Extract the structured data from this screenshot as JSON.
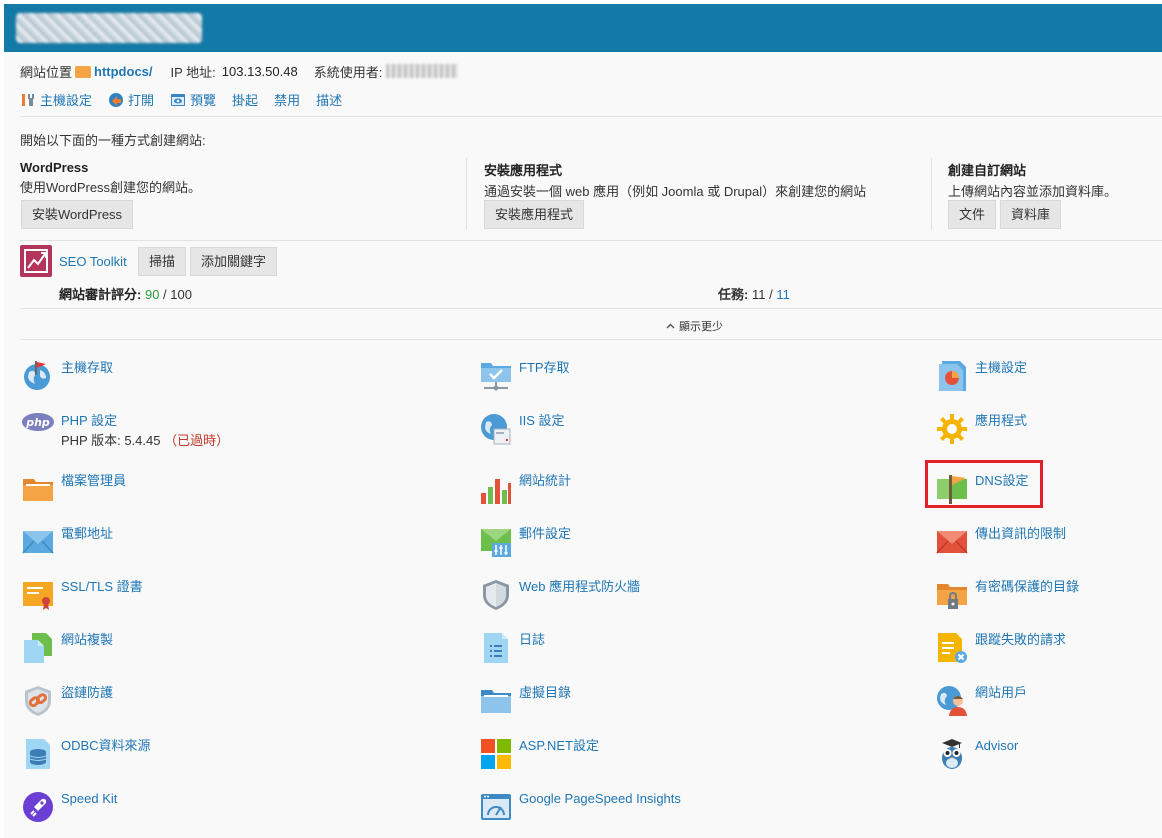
{
  "header": {
    "site_label": "網站位置",
    "site_path": "httpdocs/",
    "ip_label": "IP 地址:",
    "ip_value": "103.13.50.48",
    "user_label": "系統使用者:"
  },
  "actions": [
    {
      "label": "主機設定",
      "icon": "tools-icon"
    },
    {
      "label": "打開",
      "icon": "open-icon"
    },
    {
      "label": "預覽",
      "icon": "preview-icon"
    },
    {
      "label": "掛起",
      "icon": ""
    },
    {
      "label": "禁用",
      "icon": ""
    },
    {
      "label": "描述",
      "icon": ""
    }
  ],
  "create": {
    "intro": "開始以下面的一種方式創建網站:",
    "wordpress": {
      "title": "WordPress",
      "desc": "使用WordPress創建您的網站。",
      "button": "安裝WordPress"
    },
    "apps": {
      "title": "安裝應用程式",
      "desc": "通過安裝一個 web 應用（例如 Joomla 或 Drupal）來創建您的網站",
      "button": "安裝應用程式"
    },
    "custom": {
      "title": "創建自訂網站",
      "desc": "上傳網站內容並添加資料庫。",
      "files_button": "文件",
      "db_button": "資料庫"
    }
  },
  "seo": {
    "name": "SEO Toolkit",
    "scan_button": "掃描",
    "add_keyword_button": "添加關鍵字",
    "score_label": "網站審計評分:",
    "score_value": "90",
    "score_sep": " / ",
    "score_max": "100",
    "tasks_label": "任務:",
    "tasks_done": "11",
    "tasks_sep": " / ",
    "tasks_total": "11"
  },
  "show_less": "顯示更少",
  "services": {
    "hosting_access": "主機存取",
    "ftp": "FTP存取",
    "hosting_settings": "主機設定",
    "php": "PHP 設定",
    "php_version_label": "PHP 版本: 5.4.45",
    "php_outdated": "（已過時）",
    "iis": "IIS 設定",
    "applications": "應用程式",
    "file_manager": "檔案管理員",
    "web_stats": "網站統計",
    "dns": "DNS設定",
    "mail_addresses": "電郵地址",
    "mail_settings": "郵件設定",
    "outgoing_limits": "傳出資訊的限制",
    "ssl": "SSL/TLS 證書",
    "waf": "Web 應用程式防火牆",
    "password_dirs": "有密碼保護的目錄",
    "site_copy": "網站複製",
    "logs": "日誌",
    "failed_requests": "跟蹤失敗的請求",
    "hotlink": "盜鏈防護",
    "virtual_dirs": "虛擬目錄",
    "web_users": "網站用戶",
    "odbc": "ODBC資料來源",
    "aspnet": "ASP.NET設定",
    "advisor": "Advisor",
    "speed_kit": "Speed Kit",
    "pagespeed": "Google PageSpeed Insights"
  },
  "colors": {
    "topbar": "#1379a6",
    "link": "#1f76b5",
    "highlight": "#e0202a",
    "score_good": "#2e9e3e",
    "warn": "#c0392b"
  }
}
